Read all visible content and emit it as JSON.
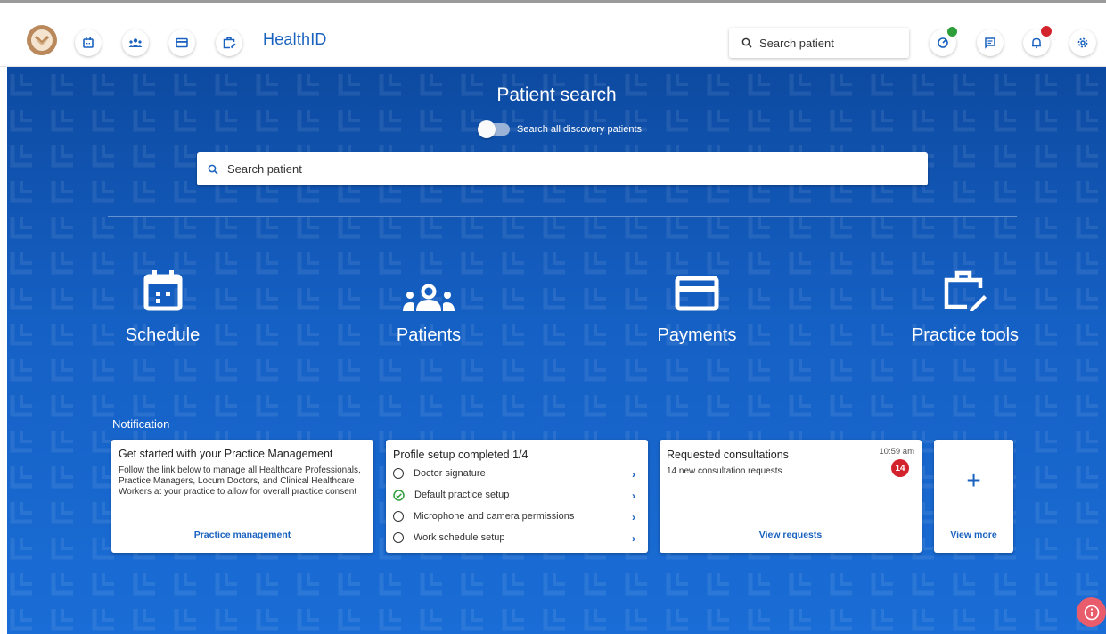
{
  "header": {
    "app_title": "HealthID",
    "logo_icon": "discovery-logo-icon",
    "nav_icons": [
      "calendar-icon",
      "patients-icon",
      "payment-card-icon",
      "practice-tools-icon"
    ],
    "search_placeholder": "Search patient",
    "right_icons": [
      "status-icon",
      "messages-icon",
      "notifications-icon",
      "settings-icon"
    ],
    "status_dot_color": "#2e9e3a",
    "notification_dot_color": "#d3242e"
  },
  "patient_search": {
    "title": "Patient search",
    "toggle_label": "Search all discovery patients",
    "toggle_on": false,
    "search_placeholder": "Search patient"
  },
  "tiles": [
    {
      "label": "Schedule",
      "icon": "calendar-icon"
    },
    {
      "label": "Patients",
      "icon": "patients-icon"
    },
    {
      "label": "Payments",
      "icon": "payment-card-icon"
    },
    {
      "label": "Practice tools",
      "icon": "practice-tools-icon"
    }
  ],
  "notifications": {
    "title": "Notification",
    "practice_card": {
      "title": "Get started with your Practice Management",
      "body": "Follow the link below to manage all Healthcare Professionals, Practice Managers, Locum Doctors, and Clinical Healthcare Workers at your practice to allow for overall practice consent",
      "link": "Practice management"
    },
    "profile_card": {
      "title": "Profile setup completed 1/4",
      "items": [
        {
          "label": "Doctor signature",
          "done": false
        },
        {
          "label": "Default practice setup",
          "done": true
        },
        {
          "label": "Microphone and camera permissions",
          "done": false
        },
        {
          "label": "Work schedule setup",
          "done": false
        }
      ]
    },
    "consultations_card": {
      "title": "Requested consultations",
      "time": "10:59 am",
      "body": "14 new consultation requests",
      "badge": "14",
      "link": "View requests"
    },
    "more_card": {
      "plus": "+",
      "link": "View more"
    }
  },
  "colors": {
    "brand_blue": "#1a62bf",
    "background_blue": "#1560c4",
    "info_button": "#e85c6c",
    "check_green": "#2e9e3a"
  }
}
